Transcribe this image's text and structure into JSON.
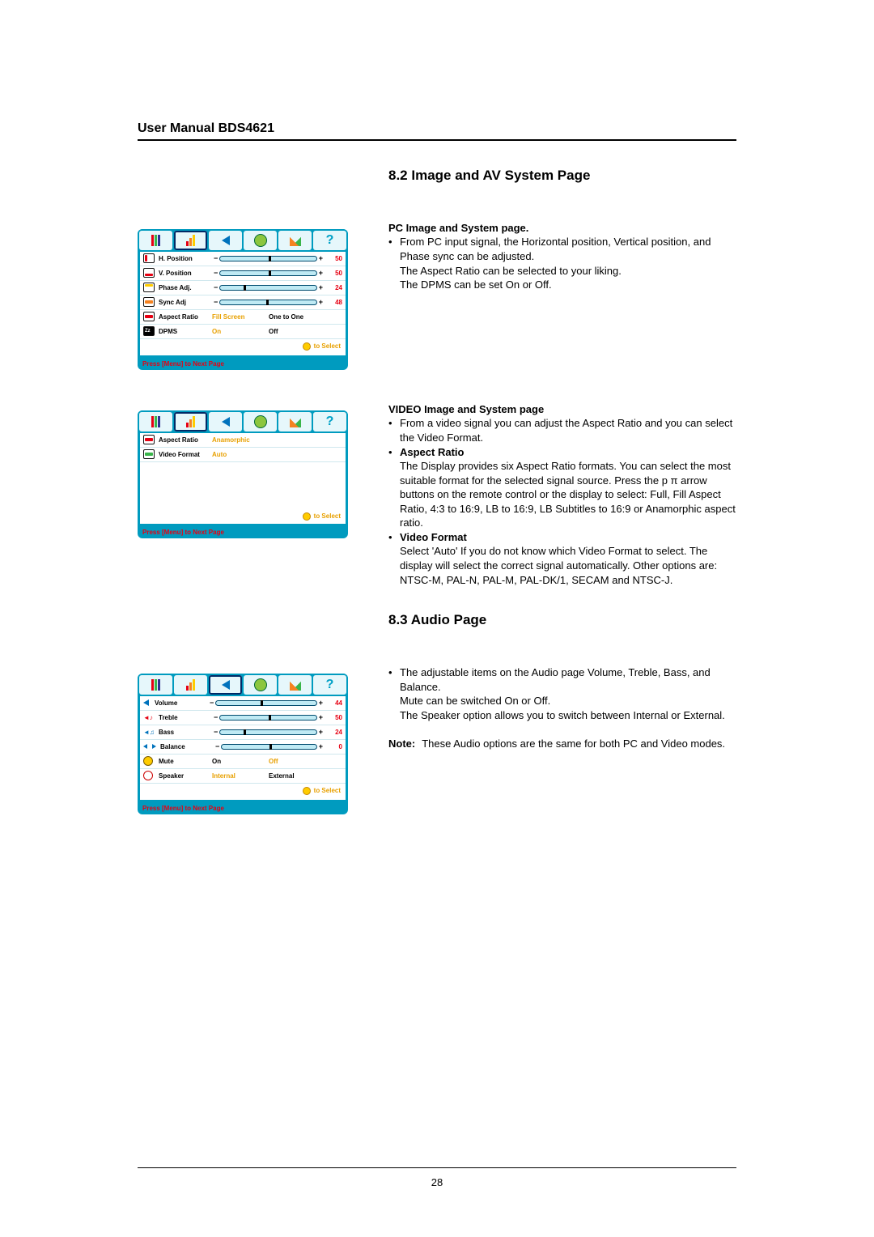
{
  "header": "User Manual BDS4621",
  "pageNumber": "28",
  "sections": {
    "sec82": {
      "title": "8.2 Image and AV System Page",
      "pc": {
        "heading": "PC Image and System page.",
        "bullet": "From PC input signal, the Horizontal position, Vertical position, and Phase sync can be adjusted.",
        "line2": "The Aspect Ratio can be selected to your liking.",
        "line3": "The DPMS can be set On or Off."
      },
      "video": {
        "heading": "VIDEO Image and System page",
        "bullet1": "From a video signal you can adjust the Aspect Ratio and you can select the Video Format.",
        "ar_label": "Aspect Ratio",
        "ar_body": "The Display provides six Aspect Ratio formats. You can select the most suitable format for the selected signal source. Press the p π arrow buttons on the remote control or the display to select: Full, Fill Aspect Ratio, 4:3 to 16:9, LB to 16:9, LB Subtitles to 16:9 or Anamorphic aspect ratio.",
        "vf_label": "Video Format",
        "vf_body": "Select 'Auto' If you do not know which Video Format to select. The display will select the correct signal automatically. Other options are: NTSC-M, PAL-N, PAL-M, PAL-DK/1, SECAM and NTSC-J."
      }
    },
    "sec83": {
      "title": "8.3 Audio Page",
      "bullet": "The adjustable items on the Audio page Volume, Treble, Bass, and Balance.",
      "line2": "Mute can be switched On or Off.",
      "line3": "The Speaker option allows you to switch between Internal or External.",
      "note_label": "Note:",
      "note": "These Audio options are the same for both PC and Video modes."
    }
  },
  "osd_common": {
    "select": "to Select",
    "menu_next": "Press [Menu] to Next Page"
  },
  "osd1": {
    "rows": [
      {
        "label": "H. Position",
        "val": "50",
        "knob": 50
      },
      {
        "label": "V. Position",
        "val": "50",
        "knob": 50
      },
      {
        "label": "Phase Adj.",
        "val": "24",
        "knob": 24
      },
      {
        "label": "Sync Adj",
        "val": "48",
        "knob": 48
      }
    ],
    "aspect": {
      "label": "Aspect Ratio",
      "opt_active": "Fill Screen",
      "opt_other": "One to One"
    },
    "dpms": {
      "label": "DPMS",
      "opt_active": "On",
      "opt_other": "Off"
    }
  },
  "osd2": {
    "aspect": {
      "label": "Aspect Ratio",
      "value": "Anamorphic"
    },
    "vformat": {
      "label": "Video Format",
      "value": "Auto"
    }
  },
  "osd3": {
    "rows": [
      {
        "label": "Volume",
        "val": "44",
        "knob": 44
      },
      {
        "label": "Treble",
        "val": "50",
        "knob": 50
      },
      {
        "label": "Bass",
        "val": "24",
        "knob": 24
      },
      {
        "label": "Balance",
        "val": "0",
        "knob": 50
      }
    ],
    "mute": {
      "label": "Mute",
      "opt_other": "On",
      "opt_active": "Off"
    },
    "speaker": {
      "label": "Speaker",
      "opt_active": "Internal",
      "opt_other": "External"
    }
  }
}
